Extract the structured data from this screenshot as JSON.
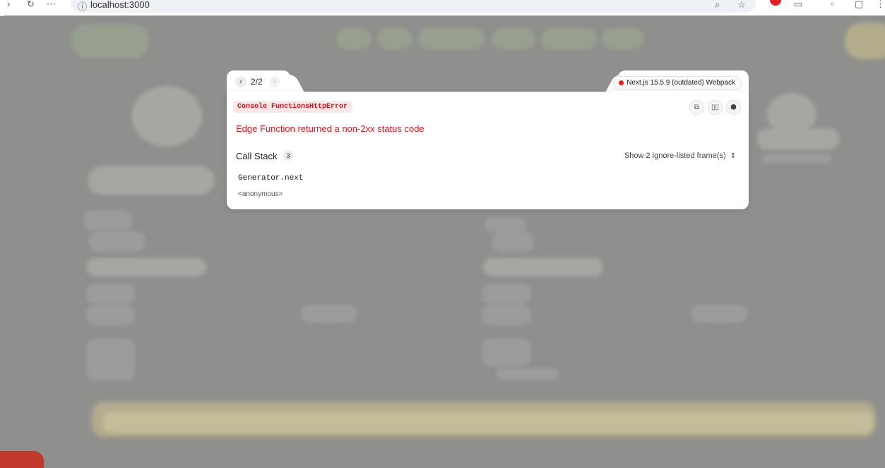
{
  "browser": {
    "url": "localhost:3000"
  },
  "overlay": {
    "pager": "2/2",
    "prev_icon": "chevron-left-icon",
    "next_icon": "chevron-right-icon",
    "version_label": "Next.js 15.5.9 (outdated) Webpack",
    "version_status_color": "#e5201b",
    "error_type": "Console FunctionsHttpError",
    "error_message": "Edge Function returned a non-2xx status code",
    "tools": [
      {
        "icon": "copy-icon"
      },
      {
        "icon": "docs-book-icon"
      },
      {
        "icon": "nodejs-icon"
      }
    ],
    "call_stack": {
      "title": "Call Stack",
      "count": "3",
      "ignore_toggle": "Show 2 ignore-listed frame(s)",
      "frames": [
        {
          "fn": "Generator.next",
          "location": "<anonymous>"
        }
      ]
    }
  },
  "colors": {
    "error_red": "#d11a1f",
    "backdrop": "#8e8e8c"
  }
}
